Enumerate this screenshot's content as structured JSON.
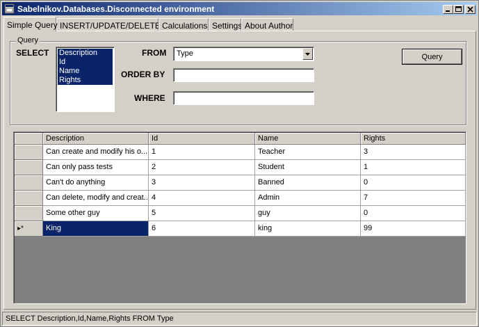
{
  "window": {
    "title": "Sabelnikov.Databases.Disconnected environment",
    "controls": [
      "minimize-icon",
      "maximize-icon",
      "close-icon"
    ]
  },
  "tabs": [
    {
      "label": "Simple Query",
      "active": true
    },
    {
      "label": "INSERT/UPDATE/DELETE",
      "active": false
    },
    {
      "label": "Calculations",
      "active": false
    },
    {
      "label": "Settings",
      "active": false
    },
    {
      "label": "About Author",
      "active": false
    }
  ],
  "query": {
    "group_label": "Query",
    "select_label": "SELECT",
    "select_items": [
      "Description",
      "Id",
      "Name",
      "Rights"
    ],
    "from_label": "FROM",
    "from_value": "Type",
    "order_by_label": "ORDER BY",
    "order_by_value": "",
    "where_label": "WHERE",
    "where_value": "",
    "button_label": "Query"
  },
  "grid": {
    "columns": [
      "Description",
      "Id",
      "Name",
      "Rights"
    ],
    "rows": [
      [
        "Can create and modify his o...",
        "1",
        "Teacher",
        "3"
      ],
      [
        "Can only pass tests",
        "2",
        "Student",
        "1"
      ],
      [
        "Can't do anything",
        "3",
        "Banned",
        "0"
      ],
      [
        "Can delete, modify and creat...",
        "4",
        "Admin",
        "7"
      ],
      [
        "Some other guy",
        "5",
        "guy",
        "0"
      ],
      [
        "King",
        "6",
        "king",
        "99"
      ]
    ],
    "current_row_indicator": "▸*"
  },
  "status": {
    "text": "SELECT Description,Id,Name,Rights FROM Type"
  }
}
